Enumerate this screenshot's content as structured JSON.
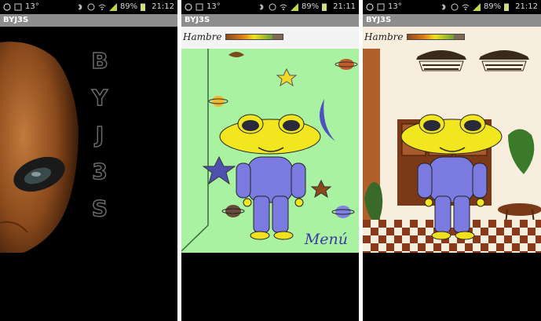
{
  "status_bar": {
    "time_1": "21:12",
    "time_2": "21:11",
    "time_3": "21:12",
    "battery": "89%",
    "temp": "13°"
  },
  "app": {
    "title": "BYJ3S"
  },
  "splash": {
    "letters": [
      "B",
      "Y",
      "J",
      "3",
      "S"
    ]
  },
  "hunger": {
    "label": "Hambre",
    "level_fraction": 0.82
  },
  "room": {
    "menu_label": "Menú"
  },
  "colors": {
    "title_bar": "#8d8d8d",
    "room_bg": "#a9f2a2",
    "kitchen_wall": "#f7eedd"
  }
}
